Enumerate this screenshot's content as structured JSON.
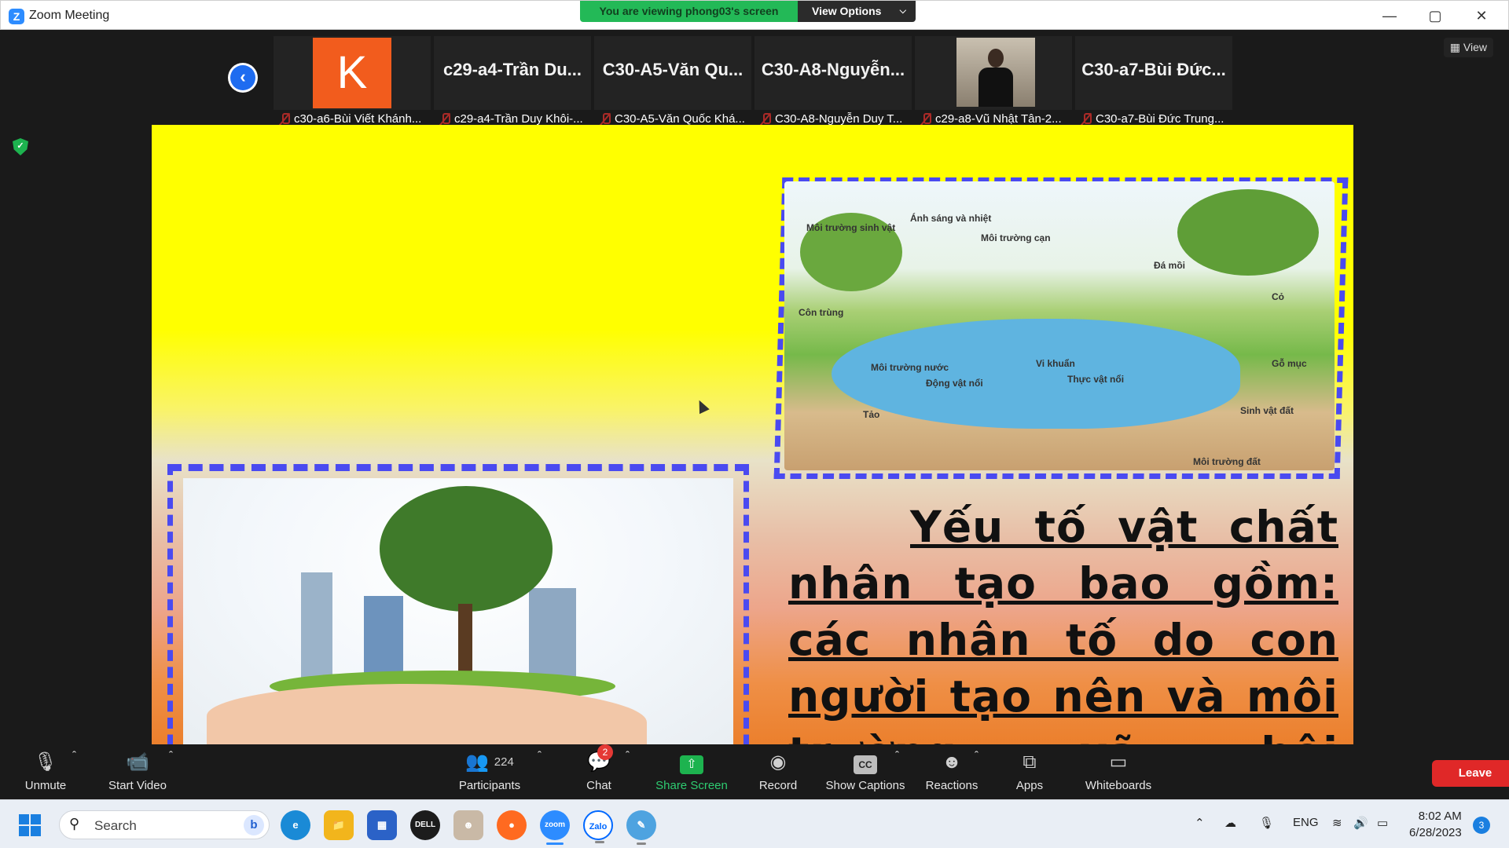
{
  "window": {
    "app_title": "Zoom Meeting",
    "logo_letter": "Z",
    "viewing_text": "You are viewing phong03's screen",
    "view_options_label": "View Options"
  },
  "meeting": {
    "view_label": "View",
    "participants": [
      {
        "display": "K",
        "name": "c30-a6-Bùi Viết Khánh..."
      },
      {
        "display": "c29-a4-Trần Du...",
        "name": "c29-a4-Trần Duy Khôi-..."
      },
      {
        "display": "C30-A5-Văn Qu...",
        "name": "C30-A5-Văn Quốc Khá..."
      },
      {
        "display": "C30-A8-Nguyễn...",
        "name": "C30-A8-Nguyễn Duy T..."
      },
      {
        "display": "",
        "name": "c29-a8-Vũ Nhật Tân-2..."
      },
      {
        "display": "C30-a7-Bùi Đức...",
        "name": "C30-a7-Bùi Đức Trung..."
      }
    ]
  },
  "slide": {
    "text": "Yếu tố vật chất nhân tạo bao gồm: các nhân tố do con người tạo nên và môi trường xã hội",
    "eco_labels": [
      "Môi trường sinh vật",
      "Ánh sáng và nhiệt",
      "Môi trường cạn",
      "Môi trường nước",
      "Môi trường đất",
      "Đá mồi",
      "Cỏ",
      "Côn trùng",
      "Vi khuẩn",
      "Thực vật nổi",
      "Động vật nổi",
      "Tảo",
      "Gỗ mục",
      "Sinh vật đất"
    ]
  },
  "toolbar": {
    "unmute": "Unmute",
    "start_video": "Start Video",
    "participants_label": "Participants",
    "participants_count": "224",
    "chat_label": "Chat",
    "chat_badge": "2",
    "share_screen": "Share Screen",
    "record": "Record",
    "cc_icon_text": "CC",
    "show_captions": "Show Captions",
    "reactions": "Reactions",
    "apps": "Apps",
    "whiteboards": "Whiteboards",
    "leave": "Leave"
  },
  "taskbar": {
    "search_placeholder": "Search",
    "bing_letter": "b",
    "dell_label": "DELL",
    "zoom_label": "zoom",
    "zalo_label": "Zalo",
    "language": "ENG",
    "time": "8:02 AM",
    "date": "6/28/2023",
    "notification_count": "3"
  },
  "colors": {
    "zoom_blue": "#2d8cff",
    "viewing_green": "#23b957",
    "leave_red": "#e02828",
    "slide_yellow": "#ffff00",
    "dash_blue": "#4a4af0",
    "avatar_orange": "#f25c1d"
  }
}
